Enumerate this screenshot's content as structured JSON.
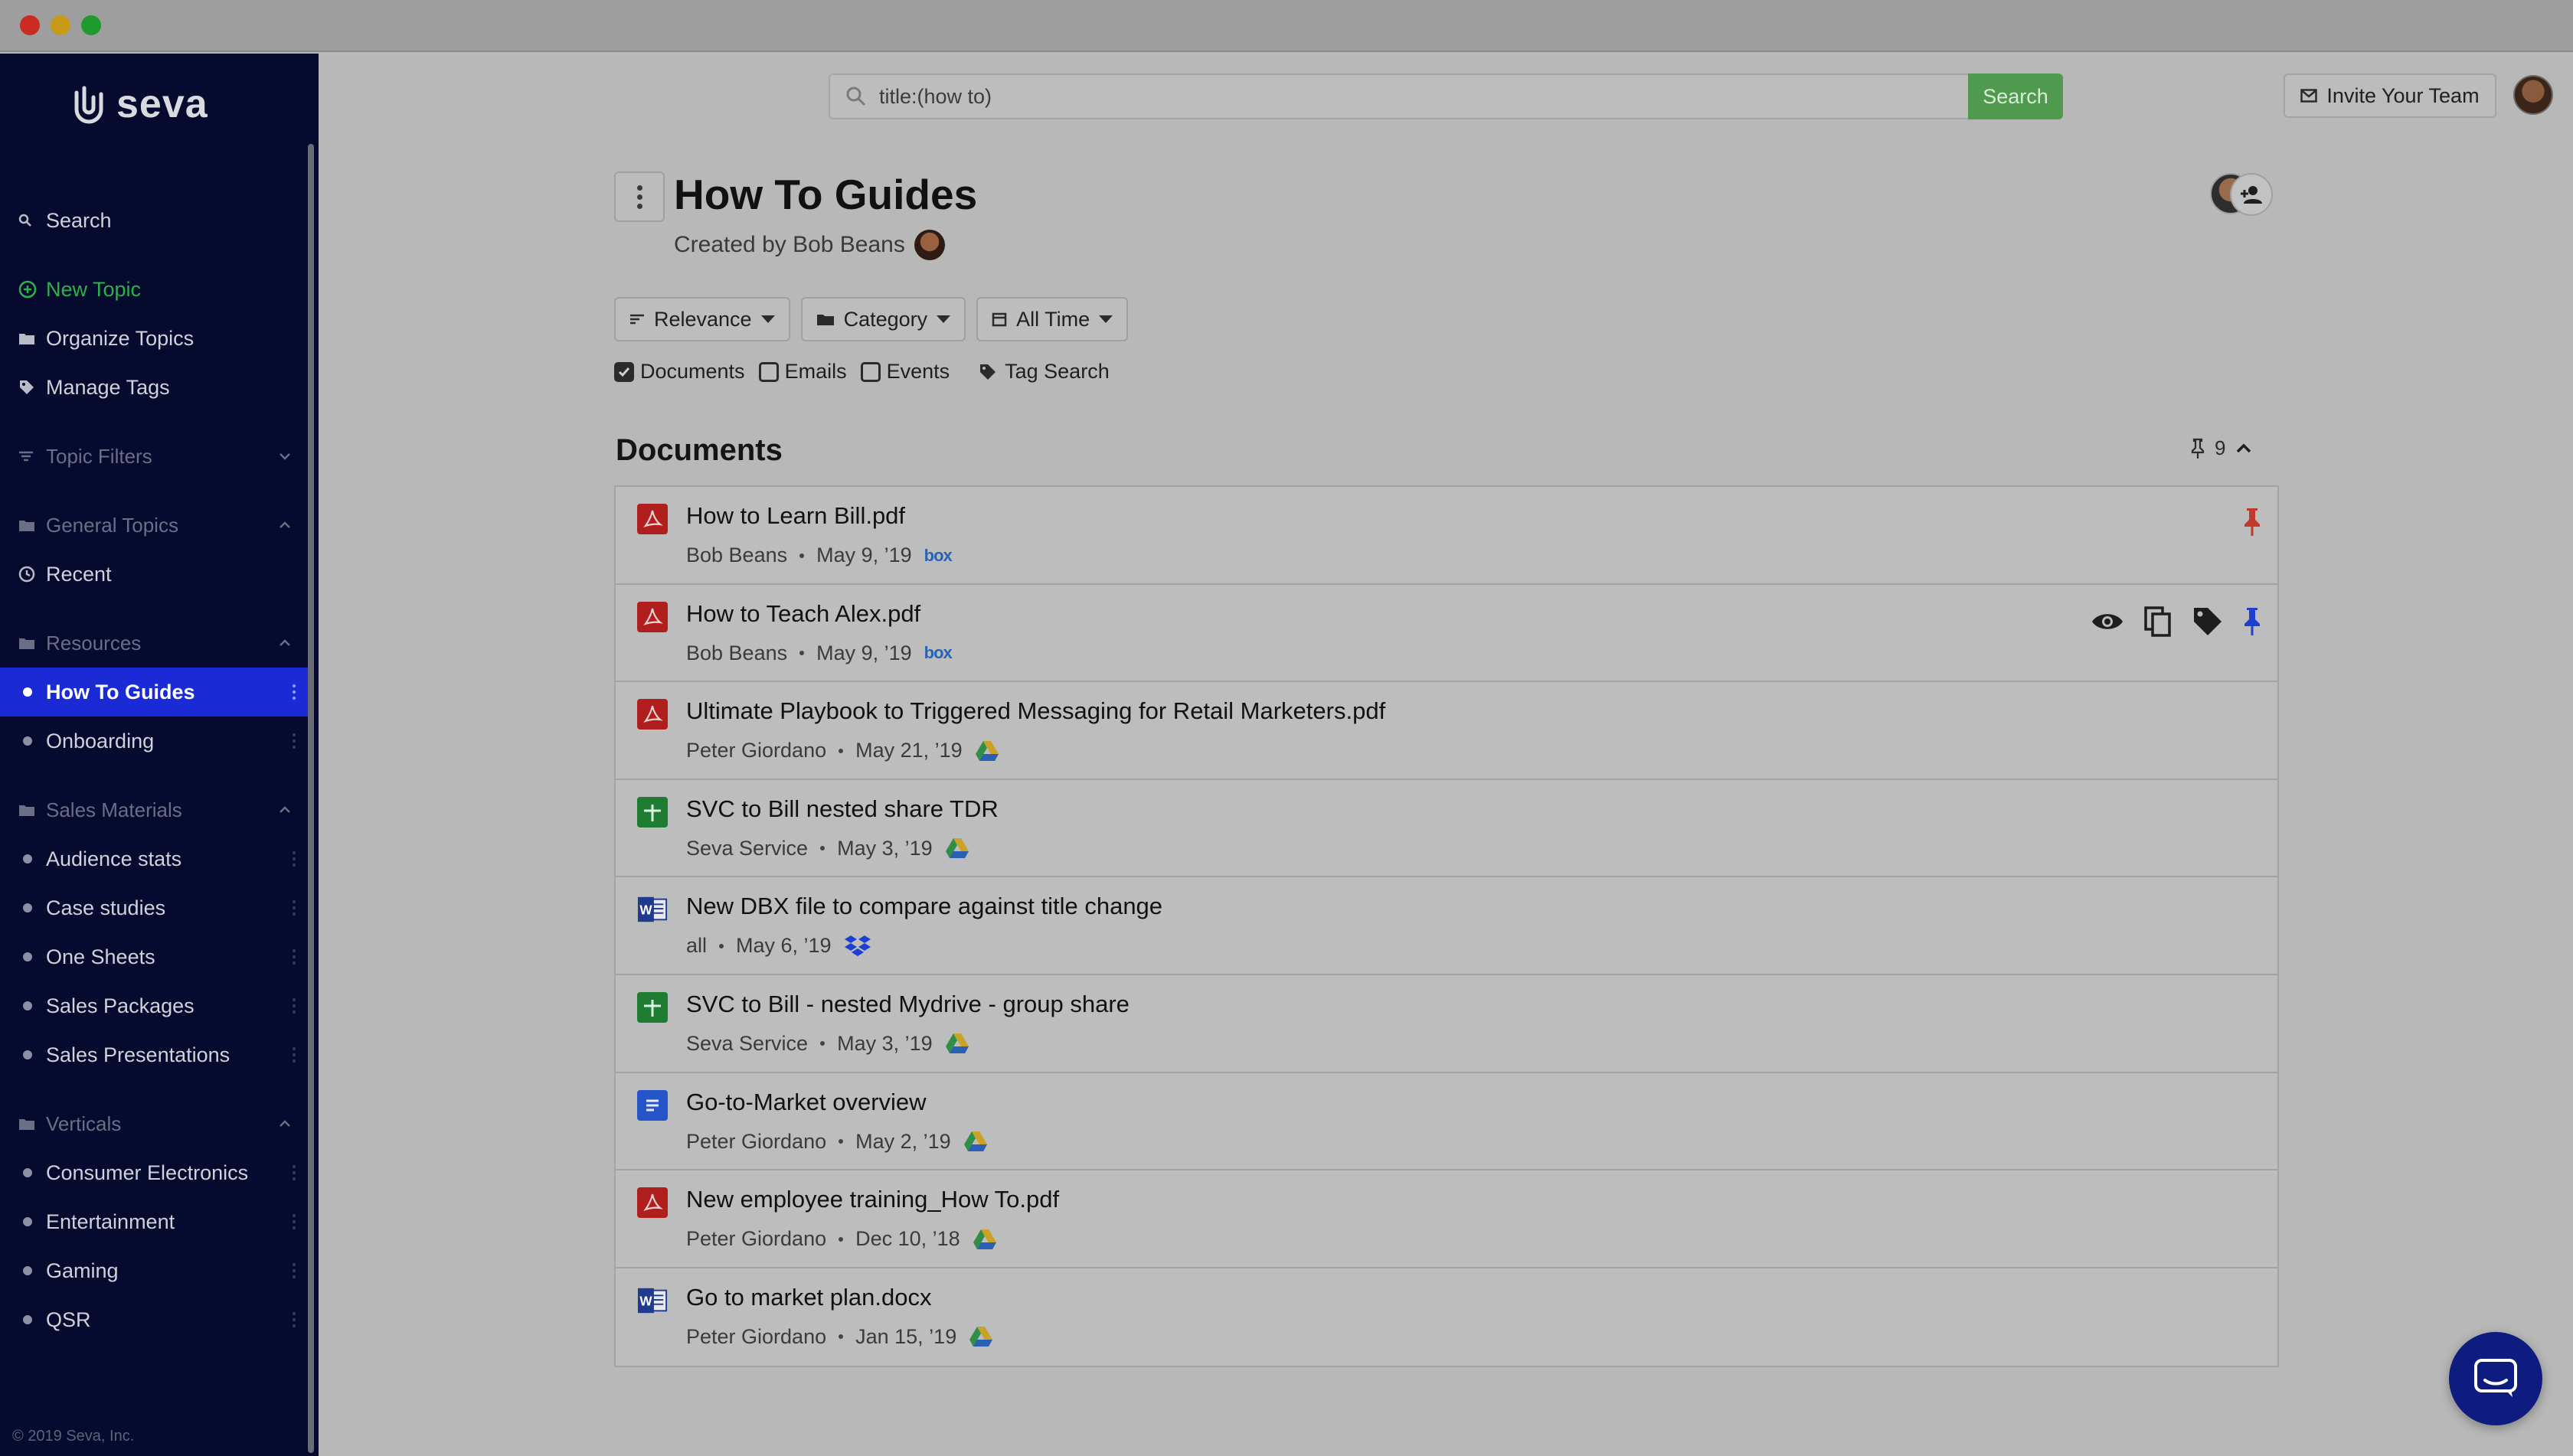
{
  "search": {
    "query": "title:(how to)",
    "button_label": "Search"
  },
  "header": {
    "invite_label": "Invite Your Team"
  },
  "sidebar": {
    "brand": "seva",
    "search_label": "Search",
    "new_topic": "New Topic",
    "organize_topics": "Organize Topics",
    "manage_tags": "Manage Tags",
    "topic_filters": "Topic Filters",
    "general_topics": "General Topics",
    "recent": "Recent",
    "resources": "Resources",
    "resources_items": [
      "How To Guides",
      "Onboarding"
    ],
    "sales_materials": "Sales Materials",
    "sales_items": [
      "Audience stats",
      "Case studies",
      "One Sheets",
      "Sales Packages",
      "Sales Presentations"
    ],
    "verticals": "Verticals",
    "vertical_items": [
      "Consumer Electronics",
      "Entertainment",
      "Gaming",
      "QSR"
    ],
    "copyright": "© 2019 Seva, Inc."
  },
  "page": {
    "title": "How To Guides",
    "created_by": "Created by Bob Beans"
  },
  "filters": {
    "sort": "Relevance",
    "category": "Category",
    "time": "All Time"
  },
  "types": {
    "documents": "Documents",
    "emails": "Emails",
    "events": "Events",
    "tag_search": "Tag Search"
  },
  "documents": {
    "section_title": "Documents",
    "pinned_count": "9",
    "items": [
      {
        "title": "How to Learn Bill.pdf",
        "author": "Bob Beans",
        "date": "May 9, ’19",
        "type": "pdf",
        "source": "box",
        "source_label": "box"
      },
      {
        "title": "How to Teach Alex.pdf",
        "author": "Bob Beans",
        "date": "May 9, ’19",
        "type": "pdf",
        "source": "box",
        "source_label": "box"
      },
      {
        "title": "Ultimate Playbook to Triggered Messaging for Retail Marketers.pdf",
        "author": "Peter Giordano",
        "date": "May 21, ’19",
        "type": "pdf",
        "source": "gdrive",
        "source_label": ""
      },
      {
        "title": "SVC to Bill nested share TDR",
        "author": "Seva Service",
        "date": "May 3, ’19",
        "type": "sheet",
        "source": "gdrive",
        "source_label": ""
      },
      {
        "title": "New DBX file to compare against title change",
        "author": "all",
        "date": "May 6, ’19",
        "type": "word",
        "source": "dropbox",
        "source_label": ""
      },
      {
        "title": "SVC to Bill - nested Mydrive - group share",
        "author": "Seva Service",
        "date": "May 3, ’19",
        "type": "sheet",
        "source": "gdrive",
        "source_label": ""
      },
      {
        "title": "Go-to-Market overview",
        "author": "Peter Giordano",
        "date": "May 2, ’19",
        "type": "gdoc",
        "source": "gdrive",
        "source_label": ""
      },
      {
        "title": "New employee training_How To.pdf",
        "author": "Peter Giordano",
        "date": "Dec 10, ’18",
        "type": "pdf",
        "source": "gdrive",
        "source_label": ""
      },
      {
        "title": "Go to market plan.docx",
        "author": "Peter Giordano",
        "date": "Jan 15, ’19",
        "type": "word",
        "source": "gdrive",
        "source_label": ""
      }
    ]
  },
  "colors": {
    "sidebar_bg": "#050a2e",
    "sidebar_active": "#1a2bd6",
    "new_topic_green": "#2bb24a",
    "search_green": "#4f9a4f",
    "pin_red": "#c0392b",
    "pin_blue": "#1f3fd0",
    "pdf_red": "#b01e1e",
    "sheet_green": "#1e7d32",
    "word_blue": "#1f3a8f",
    "gdoc_blue": "#2555c9"
  }
}
